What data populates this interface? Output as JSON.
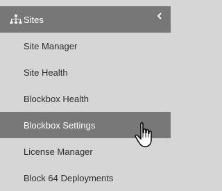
{
  "menu": {
    "header": {
      "label": "Sites",
      "icon": "sitemap-icon",
      "toggle_icon": "chevron-left-icon"
    },
    "items": [
      {
        "label": "Site Manager",
        "active": false
      },
      {
        "label": "Site Health",
        "active": false
      },
      {
        "label": "Blockbox Health",
        "active": false
      },
      {
        "label": "Blockbox Settings",
        "active": true
      },
      {
        "label": "License Manager",
        "active": false
      },
      {
        "label": "Block 64 Deployments",
        "active": false
      }
    ]
  },
  "colors": {
    "background": "#d6d6d6",
    "header_bg": "#777777",
    "active_bg": "#787878",
    "text": "#2b2b2b",
    "text_on_dark": "#ffffff"
  },
  "cursor": {
    "type": "hand-pointer-icon"
  }
}
